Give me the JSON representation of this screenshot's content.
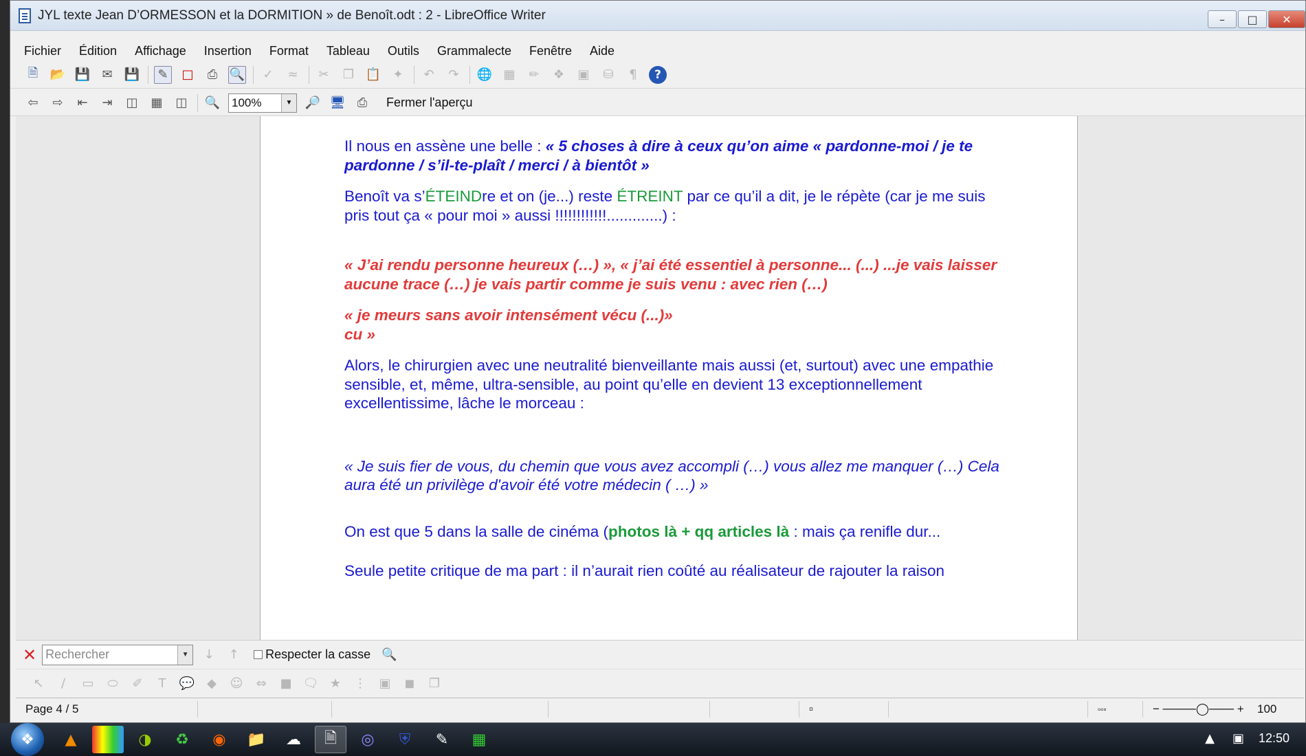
{
  "window": {
    "title": "JYL   texte Jean D’ORMESSON et la DORMITION » de Benoît.odt : 2 - LibreOffice Writer",
    "controls": [
      "–",
      "□",
      "✕"
    ]
  },
  "menu": [
    "Fichier",
    "Édition",
    "Affichage",
    "Insertion",
    "Format",
    "Tableau",
    "Outils",
    "Grammalecte",
    "Fenêtre",
    "Aide"
  ],
  "toolbar2": {
    "zoom_value": "100%",
    "close_preview": "Fermer l'aperçu"
  },
  "doc": {
    "p1_lead": "Il nous en assène une belle : ",
    "p1_quote": "« 5 choses à dire à ceux qu’on aime « pardonne-moi / je te pardonne / s’il-te-plaît / merci / à bientôt »",
    "p2_a": "Benoît va s’",
    "p2_g1": "ÉTEIND",
    "p2_b": "re et on (je...) reste ",
    "p2_g2": "ÉTREINT",
    "p2_c": " par ce qu’il a dit, je le répète (car je me suis pris tout ça « pour moi » aussi !!!!!!!!!!!!.............) :",
    "p3": "« J’ai rendu personne heureux (…) », « j’ai été essentiel à personne... (...)  ...je vais laisser aucune trace  (…) je vais partir comme je suis venu : avec rien (…)",
    "p4_line1": "« je meurs sans avoir intensément vécu  (...)»",
    "p4_line2": "cu »",
    "p5": "Alors, le chirurgien avec une neutralité bienveillante mais aussi (et, surtout) avec une empathie sensible, et, même, ultra-sensible, au point qu’elle en devient 13 exceptionnellement excellentissime,  lâche le morceau :",
    "p6": "« Je suis fier de vous, du chemin que vous avez accompli (…) vous allez me manquer (…) Cela aura été un  privilège d'avoir été votre médecin ( …) »",
    "p7_a": "On est que 5 dans la salle de cinéma  (",
    "p7_g": "photos là + qq articles là",
    "p7_b": " :  mais ça renifle dur...",
    "p8_partial": "Seule petite critique de ma part : il n’aurait rien coûté au réalisateur de rajouter la raison"
  },
  "find": {
    "placeholder": "Rechercher",
    "match_case": "Respecter la casse"
  },
  "status": {
    "page": "Page 4 / 5",
    "zoom": "100"
  },
  "taskbar": {
    "clock": "12:50"
  },
  "colors": {
    "body_text": "#1a1ad0",
    "red_quote": "#e23a3a",
    "green_highlight": "#1a9a3a"
  }
}
